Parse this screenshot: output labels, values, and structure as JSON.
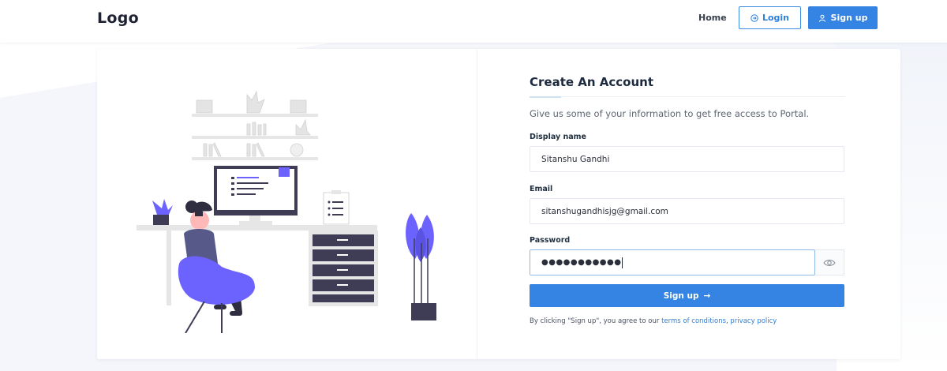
{
  "header": {
    "logo": "Logo",
    "nav": {
      "home": "Home",
      "login": "Login",
      "signup": "Sign up"
    }
  },
  "form": {
    "title": "Create An Account",
    "subtitle": "Give us some of your information to get free access to Portal.",
    "display_name": {
      "label": "Display name",
      "value": "Sitanshu Gandhi"
    },
    "email": {
      "label": "Email",
      "value": "sitanshugandhisjg@gmail.com"
    },
    "password": {
      "label": "Password",
      "masked_value": "●●●●●●●●●●●"
    },
    "submit_label": "Sign up",
    "submit_arrow": "→",
    "terms": {
      "prefix": "By clicking \"Sign up\", you agree to our ",
      "terms_link": "terms of conditions",
      "separator": ", ",
      "privacy_link": "privacy policy"
    }
  },
  "icons": {
    "login": "login-icon",
    "user": "user-icon",
    "eye": "eye-icon",
    "arrow": "arrow-right-icon"
  },
  "colors": {
    "primary": "#3584e4",
    "accent_purple": "#6c63ff",
    "dark_slate": "#3f3d56",
    "background": "#f4f6fb"
  }
}
